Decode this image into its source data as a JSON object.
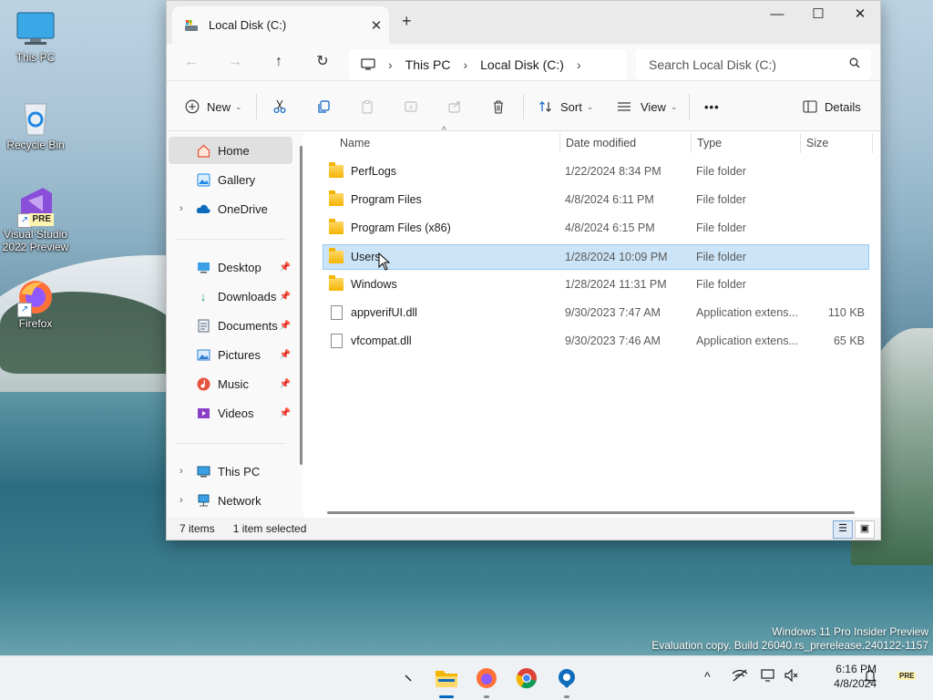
{
  "desktop": {
    "icons": [
      {
        "label": "This PC"
      },
      {
        "label": "Recycle Bin"
      },
      {
        "label": "Visual Studio 2022 Preview",
        "badge": "PRE"
      },
      {
        "label": "Firefox"
      }
    ]
  },
  "window": {
    "tab_title": "Local Disk (C:)",
    "tab_close": "✕",
    "new_tab": "+",
    "controls": {
      "minimize": "—",
      "maximize": "☐",
      "close": "✕"
    }
  },
  "address": {
    "breadcrumb": [
      "This PC",
      "Local Disk (C:)"
    ],
    "search_placeholder": "Search Local Disk (C:)"
  },
  "command_bar": {
    "new_label": "New",
    "sort_label": "Sort",
    "view_label": "View",
    "more_label": "•••",
    "details_label": "Details"
  },
  "nav_pane": {
    "home": "Home",
    "gallery": "Gallery",
    "onedrive": "OneDrive",
    "quick_access": [
      {
        "label": "Desktop",
        "icon": "desktop-icon",
        "color": "#1e88e5"
      },
      {
        "label": "Downloads",
        "icon": "download-icon",
        "color": "#1a9c6b"
      },
      {
        "label": "Documents",
        "icon": "document-icon",
        "color": "#5a6b7b"
      },
      {
        "label": "Pictures",
        "icon": "picture-icon",
        "color": "#2e7dd1"
      },
      {
        "label": "Music",
        "icon": "music-icon",
        "color": "#e5533d"
      },
      {
        "label": "Videos",
        "icon": "video-icon",
        "color": "#8a3fc7"
      }
    ],
    "this_pc": "This PC",
    "network": "Network"
  },
  "columns": {
    "name": "Name",
    "date": "Date modified",
    "type": "Type",
    "size": "Size"
  },
  "files": [
    {
      "name": "PerfLogs",
      "date": "1/22/2024 8:34 PM",
      "type": "File folder",
      "size": "",
      "kind": "folder"
    },
    {
      "name": "Program Files",
      "date": "4/8/2024 6:11 PM",
      "type": "File folder",
      "size": "",
      "kind": "folder"
    },
    {
      "name": "Program Files (x86)",
      "date": "4/8/2024 6:15 PM",
      "type": "File folder",
      "size": "",
      "kind": "folder"
    },
    {
      "name": "Users",
      "date": "1/28/2024 10:09 PM",
      "type": "File folder",
      "size": "",
      "kind": "folder",
      "selected": true
    },
    {
      "name": "Windows",
      "date": "1/28/2024 11:31 PM",
      "type": "File folder",
      "size": "",
      "kind": "folder"
    },
    {
      "name": "appverifUI.dll",
      "date": "9/30/2023 7:47 AM",
      "type": "Application extens...",
      "size": "110 KB",
      "kind": "dll"
    },
    {
      "name": "vfcompat.dll",
      "date": "9/30/2023 7:46 AM",
      "type": "Application extens...",
      "size": "65 KB",
      "kind": "dll"
    }
  ],
  "status": {
    "count": "7 items",
    "selected": "1 item selected"
  },
  "watermark": {
    "line1": "Windows 11 Pro Insider Preview",
    "line2": "Evaluation copy. Build 26040.rs_prerelease.240122-1157"
  },
  "taskbar": {
    "time": "6:16 PM",
    "date": "4/8/2024",
    "badge": "PRE"
  },
  "colors": {
    "selection": "#cce4f7",
    "accent": "#0067c0",
    "folder": "#f4b400"
  }
}
